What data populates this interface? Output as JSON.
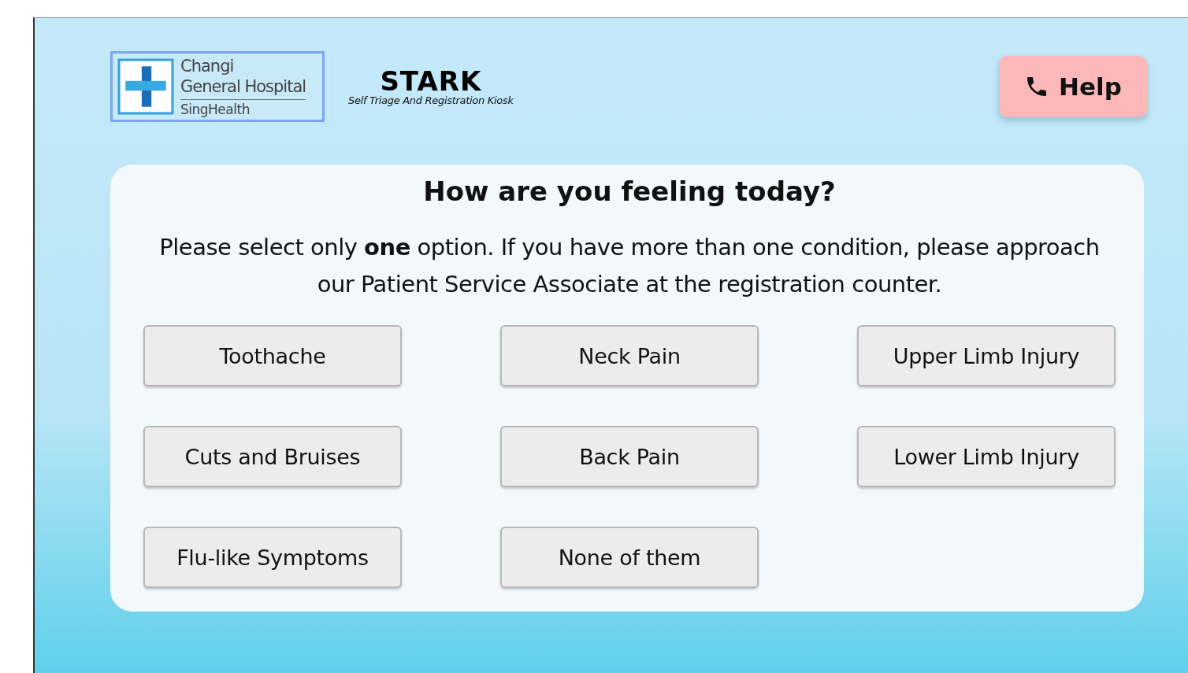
{
  "logo": {
    "line_1": "Changi",
    "line_2": "General Hospital",
    "line_3": "SingHealth"
  },
  "kiosk": {
    "name": "STARK",
    "tagline": "Self Triage And Registration Kiosk"
  },
  "help_button": {
    "label": "Help"
  },
  "panel": {
    "title": "How are you feeling today?",
    "instruction": "Please select only **one** option. If you have more than one condition, please approach our Patient Service Associate at the registration counter.",
    "options": [
      "Toothache",
      "Neck Pain",
      "Upper Limb Injury",
      "Cuts and Bruises",
      "Back Pain",
      "Lower Limb Injury",
      "Flu-like Symptoms",
      "None of them"
    ]
  }
}
